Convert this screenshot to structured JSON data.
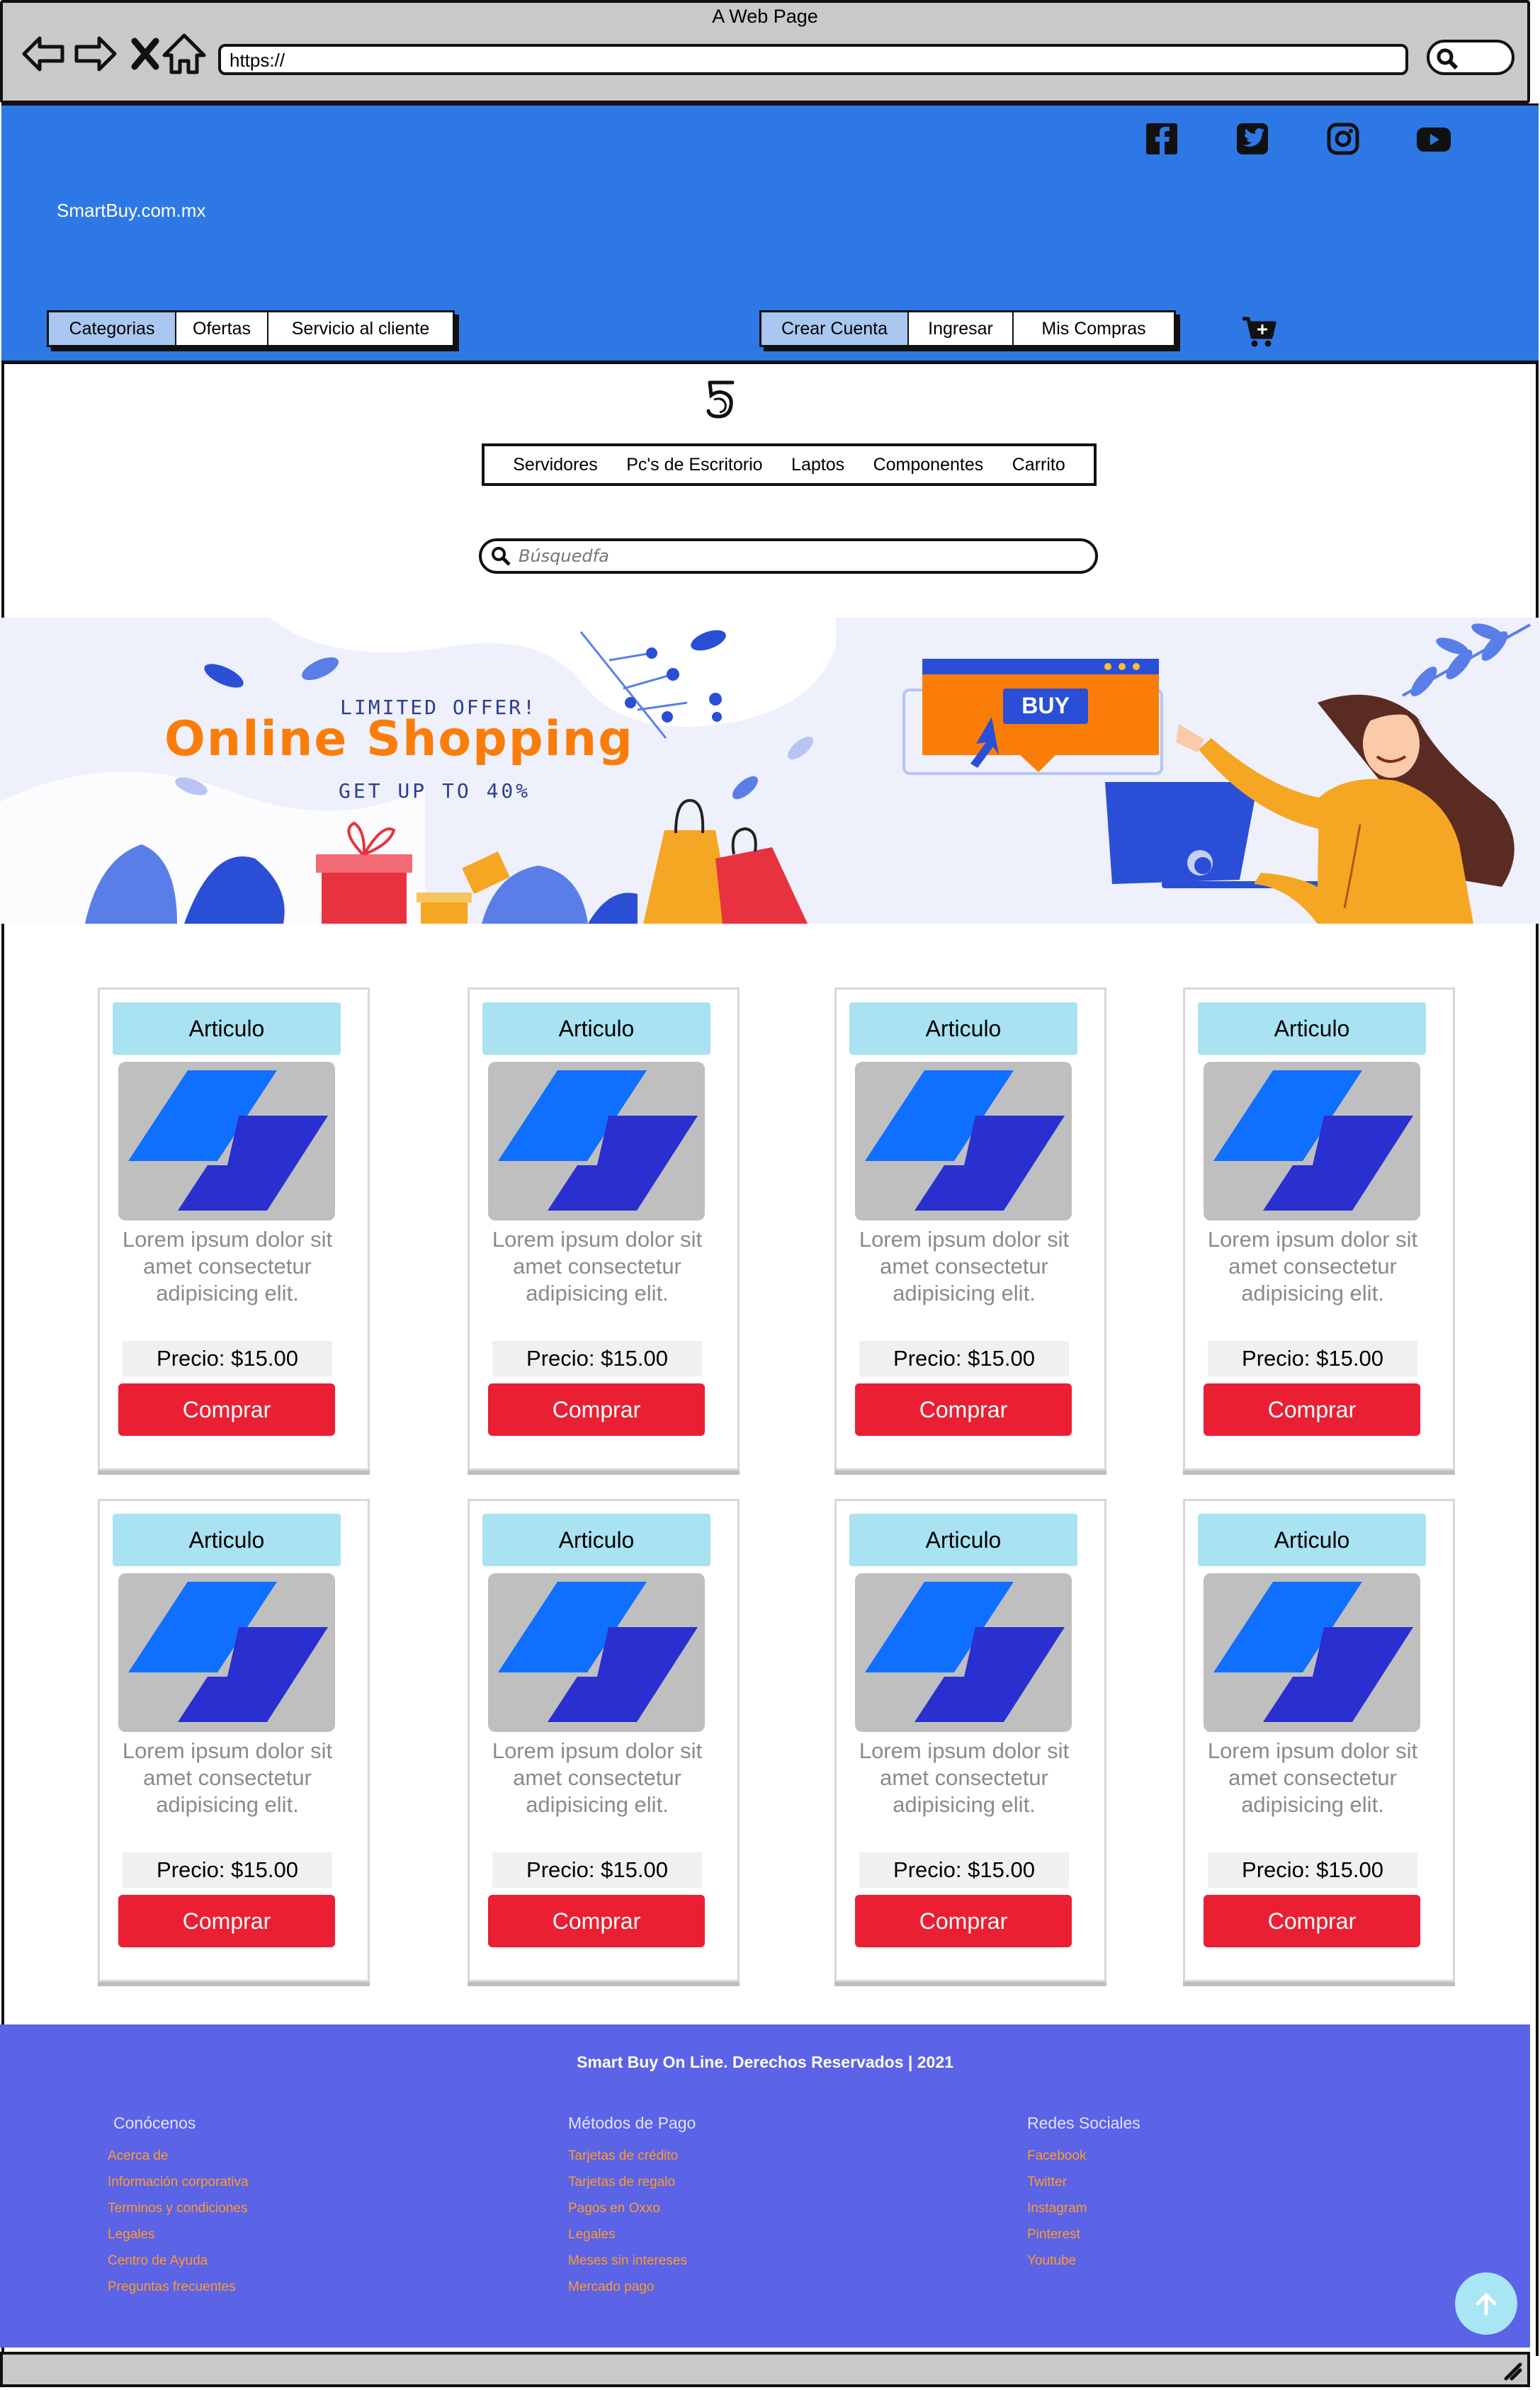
{
  "window": {
    "title": "A Web Page",
    "url": "https://"
  },
  "header": {
    "brand": "SmartBuy.com.mx",
    "social_icons": [
      "facebook-icon",
      "twitter-icon",
      "instagram-icon",
      "youtube-icon"
    ],
    "left_nav": [
      {
        "label": "Categorias",
        "active": true
      },
      {
        "label": "Ofertas",
        "active": false
      },
      {
        "label": "Servicio al cliente",
        "active": false
      }
    ],
    "right_nav": [
      {
        "label": "Crear Cuenta",
        "active": true
      },
      {
        "label": "Ingresar",
        "active": false
      },
      {
        "label": "Mis Compras",
        "active": false
      }
    ],
    "header_color": "#2e78e6"
  },
  "subnav": {
    "logo": "5",
    "items": [
      "Servidores",
      "Pc's de Escritorio",
      "Laptos",
      "Componentes",
      "Carrito"
    ]
  },
  "search": {
    "placeholder": "Búsquedfa"
  },
  "banner": {
    "kicker": "LIMITED OFFER!",
    "headline": "Online Shopping",
    "subline": "GET UP TO 40%",
    "buy_label": "BUY"
  },
  "products": [
    {
      "title": "Articulo",
      "description": "Lorem ipsum dolor sit amet consectetur adipisicing elit.",
      "price": "Precio: $15.00",
      "button": "Comprar"
    },
    {
      "title": "Articulo",
      "description": "Lorem ipsum dolor sit amet consectetur adipisicing elit.",
      "price": "Precio: $15.00",
      "button": "Comprar"
    },
    {
      "title": "Articulo",
      "description": "Lorem ipsum dolor sit amet consectetur adipisicing elit.",
      "price": "Precio: $15.00",
      "button": "Comprar"
    },
    {
      "title": "Articulo",
      "description": "Lorem ipsum dolor sit amet consectetur adipisicing elit.",
      "price": "Precio: $15.00",
      "button": "Comprar"
    },
    {
      "title": "Articulo",
      "description": "Lorem ipsum dolor sit amet consectetur adipisicing elit.",
      "price": "Precio: $15.00",
      "button": "Comprar"
    },
    {
      "title": "Articulo",
      "description": "Lorem ipsum dolor sit amet consectetur adipisicing elit.",
      "price": "Precio: $15.00",
      "button": "Comprar"
    },
    {
      "title": "Articulo",
      "description": "Lorem ipsum dolor sit amet consectetur adipisicing elit.",
      "price": "Precio: $15.00",
      "button": "Comprar"
    },
    {
      "title": "Articulo",
      "description": "Lorem ipsum dolor sit amet consectetur adipisicing elit.",
      "price": "Precio: $15.00",
      "button": "Comprar"
    }
  ],
  "footer": {
    "copyright": "Smart Buy On Line. Derechos Reservados | 2021",
    "columns": [
      {
        "heading": "Conócenos",
        "links": [
          "Acerca de",
          "Información corporativa",
          "Terminos y condiciones",
          "Legales",
          "Centro de Ayuda",
          "Preguntas frecuentes"
        ]
      },
      {
        "heading": "Métodos de Pago",
        "links": [
          "Tarjetas de crédito",
          "Tarjetas de regalo",
          "Pagos en Oxxo",
          "Legales",
          "Meses sin intereses",
          "Mercado pago"
        ]
      },
      {
        "heading": "Redes Sociales",
        "links": [
          "Facebook",
          "Twitter",
          "Instagram",
          "Pinterest",
          "Youtube"
        ]
      }
    ],
    "footer_color": "#5b63e6",
    "link_color": "#ff9c2a"
  }
}
